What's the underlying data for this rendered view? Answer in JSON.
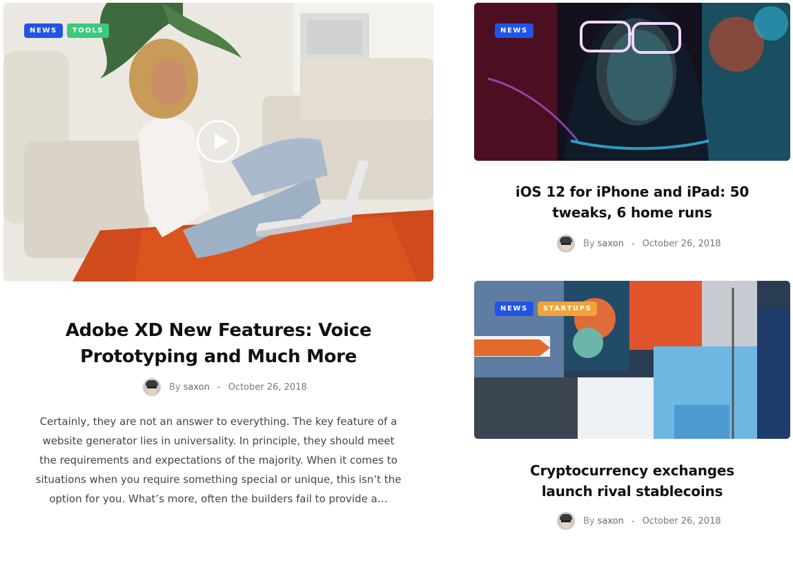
{
  "posts": [
    {
      "tags": [
        {
          "label": "NEWS",
          "color": "#2154e6"
        },
        {
          "label": "TOOLS",
          "color": "#3dc87f"
        }
      ],
      "has_video": true,
      "title_line1": "Adobe XD New Features: Voice",
      "title_line2": "Prototyping and Much More",
      "by": "By",
      "author": "saxon",
      "separator": "-",
      "date": "October 26, 2018",
      "excerpt": "Certainly, they are not an answer to everything. The key feature of a website generator lies in universality. In principle, they should meet the requirements and expectations of the majority. When it comes to situations when you require something special or unique, this isn’t the option for you. What’s more, often the builders fail to provide a…"
    },
    {
      "tags": [
        {
          "label": "NEWS",
          "color": "#2154e6"
        }
      ],
      "title_line1": "iOS 12 for iPhone and iPad: 50",
      "title_line2": "tweaks, 6 home runs",
      "by": "By",
      "author": "saxon",
      "separator": "-",
      "date": "October 26, 2018"
    },
    {
      "tags": [
        {
          "label": "NEWS",
          "color": "#2154e6"
        },
        {
          "label": "STARTUPS",
          "color": "#f0a43a"
        }
      ],
      "title_line1": "Cryptocurrency exchanges",
      "title_line2": "launch rival stablecoins",
      "by": "By",
      "author": "saxon",
      "separator": "-",
      "date": "October 26, 2018"
    }
  ]
}
